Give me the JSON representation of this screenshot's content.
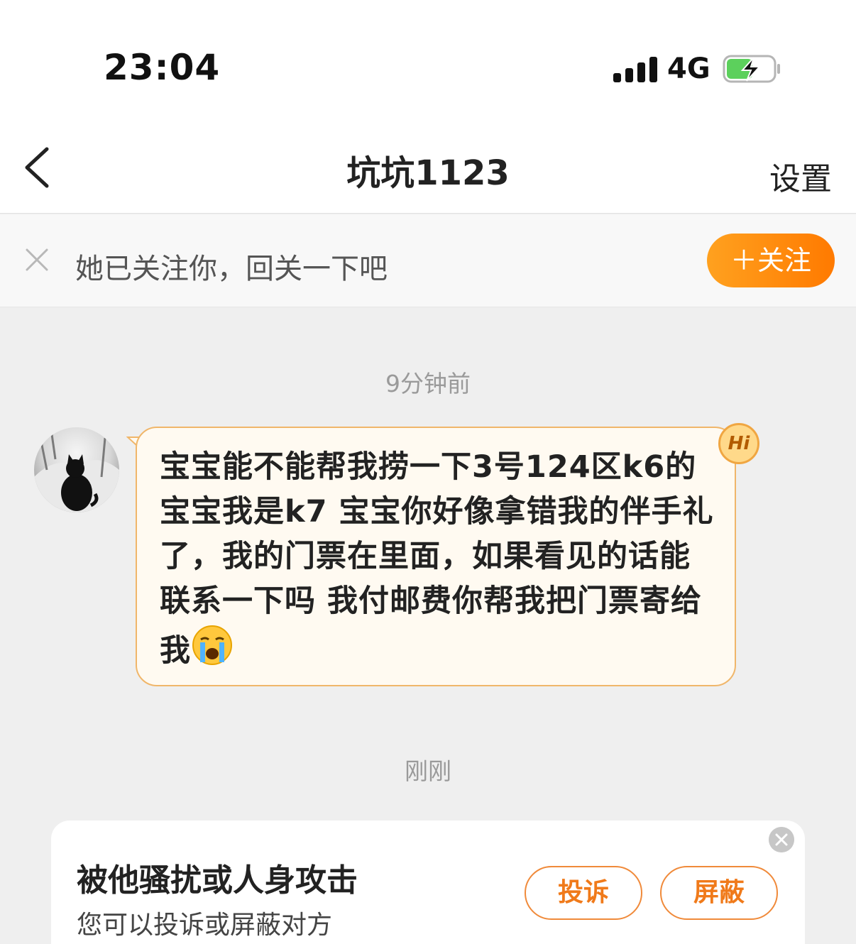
{
  "status_bar": {
    "time": "23:04",
    "network": "4G",
    "icons": [
      "signal-icon",
      "battery-charging-icon"
    ]
  },
  "nav": {
    "title": "坑坑1123",
    "settings_label": "设置",
    "back_icon": "chevron-left-icon"
  },
  "follow_banner": {
    "text": "她已关注你，回关一下吧",
    "button_label": "＋关注",
    "close_icon": "close-icon"
  },
  "messages": [
    {
      "timestamp": "9分钟前",
      "text": "宝宝能不能帮我捞一下3号124区k6的宝宝我是k7 宝宝你好像拿错我的伴手礼了，我的门票在里面，如果看见的话能联系一下吗 我付邮费你帮我把门票寄给我",
      "emoji": "loudly-crying-face",
      "badge": "Hi"
    }
  ],
  "second_timestamp": "刚刚",
  "report_card": {
    "title": "被他骚扰或人身攻击",
    "subtitle": "您可以投诉或屏蔽对方",
    "report_label": "投诉",
    "block_label": "屏蔽"
  },
  "colors": {
    "accent": "#ff8a00",
    "bubble_bg": "#fffaf1",
    "bubble_border": "#f0b66a"
  }
}
